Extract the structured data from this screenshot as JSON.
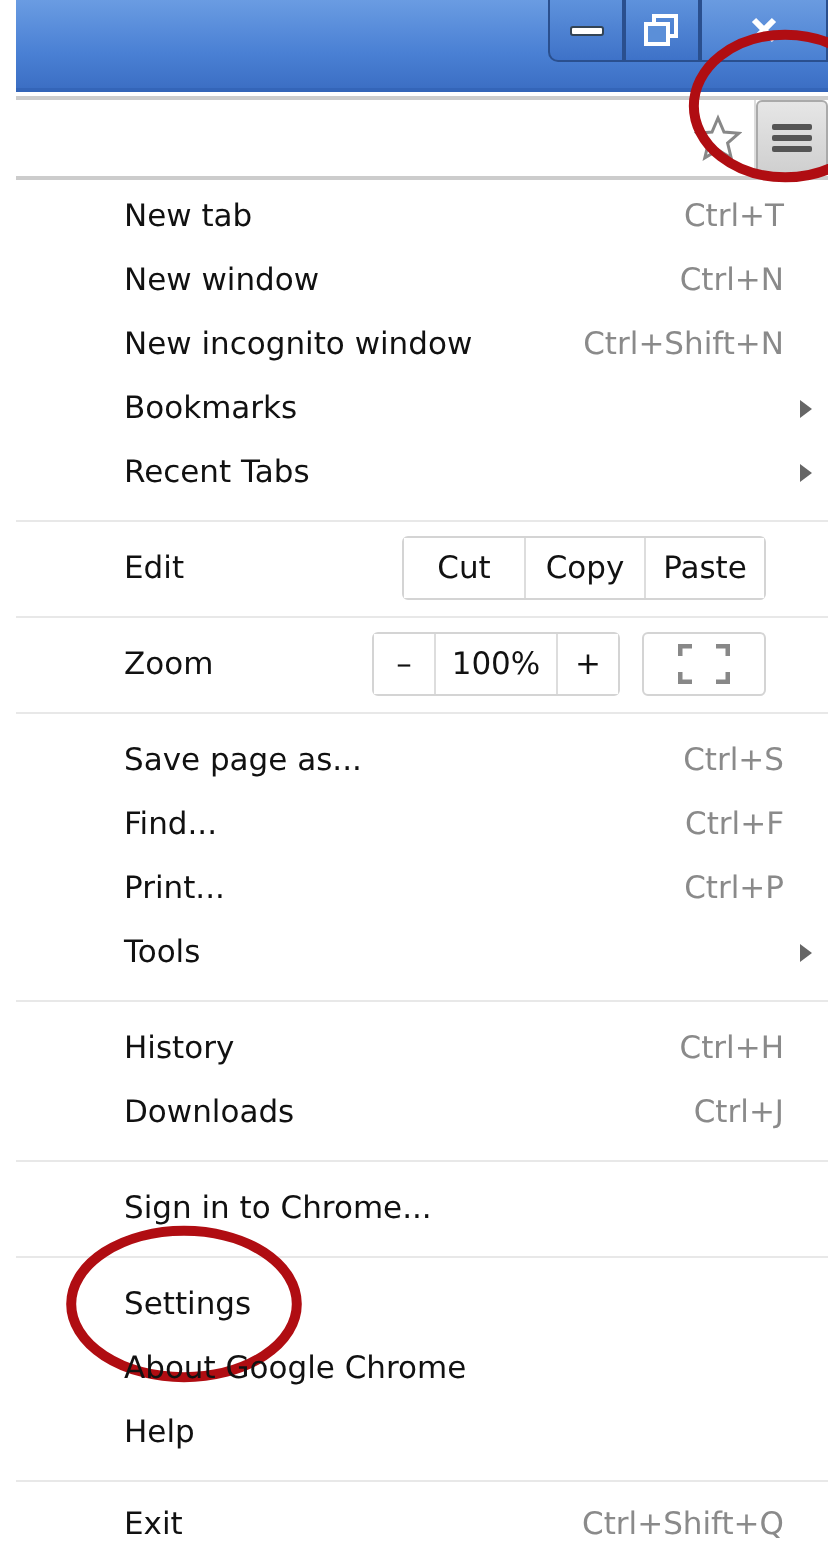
{
  "toolbar": {
    "menu_button": {
      "highlighted": true
    }
  },
  "menu": [
    {
      "kind": "item",
      "label": "New tab",
      "shortcut": "Ctrl+T",
      "submenu": false,
      "highlighted": false
    },
    {
      "kind": "item",
      "label": "New window",
      "shortcut": "Ctrl+N",
      "submenu": false,
      "highlighted": false
    },
    {
      "kind": "item",
      "label": "New incognito window",
      "shortcut": "Ctrl+Shift+N",
      "submenu": false,
      "highlighted": false
    },
    {
      "kind": "item",
      "label": "Bookmarks",
      "submenu": true,
      "highlighted": false
    },
    {
      "kind": "item",
      "label": "Recent Tabs",
      "submenu": true,
      "highlighted": false
    },
    {
      "kind": "separator"
    },
    {
      "kind": "edit",
      "label": "Edit",
      "buttons": [
        "Cut",
        "Copy",
        "Paste"
      ]
    },
    {
      "kind": "separator"
    },
    {
      "kind": "zoom",
      "label": "Zoom",
      "minus": "–",
      "value": "100%",
      "plus": "+"
    },
    {
      "kind": "separator"
    },
    {
      "kind": "item",
      "label": "Save page as...",
      "shortcut": "Ctrl+S",
      "submenu": false,
      "highlighted": false
    },
    {
      "kind": "item",
      "label": "Find...",
      "shortcut": "Ctrl+F",
      "submenu": false,
      "highlighted": false
    },
    {
      "kind": "item",
      "label": "Print...",
      "shortcut": "Ctrl+P",
      "submenu": false,
      "highlighted": false
    },
    {
      "kind": "item",
      "label": "Tools",
      "submenu": true,
      "highlighted": false
    },
    {
      "kind": "separator"
    },
    {
      "kind": "item",
      "label": "History",
      "shortcut": "Ctrl+H",
      "submenu": false,
      "highlighted": false
    },
    {
      "kind": "item",
      "label": "Downloads",
      "shortcut": "Ctrl+J",
      "submenu": false,
      "highlighted": false
    },
    {
      "kind": "separator"
    },
    {
      "kind": "item",
      "label": "Sign in to Chrome...",
      "submenu": false,
      "highlighted": false
    },
    {
      "kind": "separator"
    },
    {
      "kind": "item",
      "label": "Settings",
      "submenu": false,
      "highlighted": true
    },
    {
      "kind": "item",
      "label": "About Google Chrome",
      "submenu": false,
      "highlighted": false
    },
    {
      "kind": "item",
      "label": "Help",
      "submenu": false,
      "highlighted": false
    },
    {
      "kind": "separator"
    },
    {
      "kind": "item",
      "label": "Exit",
      "shortcut": "Ctrl+Shift+Q",
      "submenu": false,
      "highlighted": false
    }
  ]
}
